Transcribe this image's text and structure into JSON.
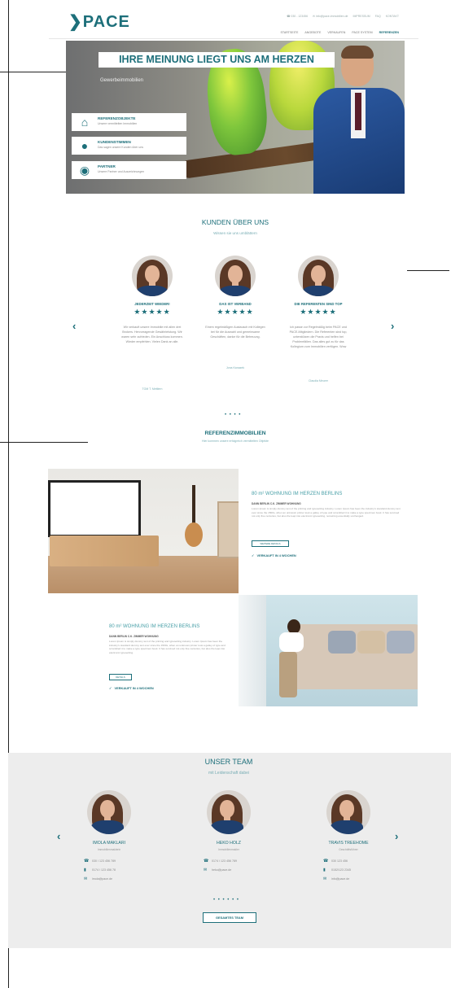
{
  "header": {
    "logo": "PACE",
    "logo_chevron": "❯",
    "top_info": [
      "☎ 030 - 123456",
      "✉ info@pace-immobilien.de",
      "IMPRESSUM",
      "FAQ",
      "KONTAKT"
    ],
    "nav": [
      "STARTSEITE",
      "ANGEBOTE",
      "VERKAUFEN",
      "PACE SYSTEM",
      "REFERENZEN"
    ],
    "active_nav": "REFERENZEN"
  },
  "hero": {
    "title": "IHRE MEINUNG LIEGT UNS AM HERZEN",
    "subtitle": "Gewerbeimmobilien",
    "items": [
      {
        "icon": "home-icon",
        "glyph": "⌂",
        "title": "REFERENZOBJEKTE",
        "desc": "Unsere vermittelten Immobilien"
      },
      {
        "icon": "person-icon",
        "glyph": "●",
        "title": "KUNDENSTIMMEN",
        "desc": "Das sagen unsere Kunden über uns"
      },
      {
        "icon": "speech-bubble-icon",
        "glyph": "◉",
        "title": "PARTNER",
        "desc": "Unsere Partner und Auszeichnungen"
      }
    ]
  },
  "kunden": {
    "title": "KUNDEN ÜBER UNS",
    "subtitle": "Wissen sie uns umblättern",
    "prev": "‹",
    "next": "›",
    "dots": "• • • •",
    "cards": [
      {
        "title": "JEDERZEIT WIEDER!",
        "stars": "★★★★★",
        "text": "Wir verkauft unsere Immobilie mit allen drei Brokers. Hervorragende Gewährleistung. Wir waren sehr zufrieden. Ein Anschluss kommen. Wieder empfehlen. Vielen Dank an alle.",
        "link": "TOM T. Mettlern"
      },
      {
        "title": "DAS IST VERBAND",
        "stars": "★★★★★",
        "text": "Einem regelmäßigen Austausch mit Kollegen bei für die Auswahl und gemeinsame Geschäften, danke für die Betreuung.",
        "link": "Jona Kanazek"
      },
      {
        "title": "DIE REFERENTEN SIND TOP",
        "stars": "★★★★★",
        "text": "Ich passe zur Regelmäßig beim PACE und PACE-Mitgliedern. Die Referenten sind top, unterstützen die Praxis und helfen bei Problemfällen. Das alles gut zu für das Kollegium zum Immobilien verfügen. Wow",
        "link": "Claudia Meurer"
      }
    ]
  },
  "referenz": {
    "title": "REFERENZIMMOBILIEN",
    "subtitle": "Hier kommen unsere erfolgreich vermittelten Objekte",
    "properties": [
      {
        "title": "80 m² WOHNUNG IM HERZEN BERLINS",
        "sub": "DANN BERLIN C.K. ZIMMER WOHNUNG",
        "text": "Lorem Ipsum is simply dummy text of the printing and typesetting industry. Lorem Ipsum has been the industry's standard dummy text ever since the 1500s, when an unknown printer took a galley of type and scrambled it to make a type specimen book. It has survived not only five centuries, but also the leap into electronic typesetting, remaining essentially unchanged.",
        "button": "WEITERE DETAILS",
        "sold": "VERKAUFT IN 4 WOCHEN"
      },
      {
        "title": "80 m² WOHNUNG IM HERZEN BERLINS",
        "sub": "DANN BERLIN C.K. ZIMMER WOHNUNG",
        "text": "Lorem Ipsum is simply dummy text of the printing and typesetting industry. Lorem Ipsum has been the industry's standard dummy text ever since the 1500s, when an unknown printer took a galley of type and scrambled it to make a type specimen book. It has survived not only five centuries, but also the leap into electronic typesetting.",
        "button": "DETAILS",
        "sold": "VERKAUFT IN 4 WOCHEN"
      }
    ]
  },
  "team": {
    "title": "UNSER TEAM",
    "subtitle": "mit Leidenschaft dabei",
    "prev": "‹",
    "next": "›",
    "dots": "• • • • • •",
    "button": "GESAMTES TEAM",
    "members": [
      {
        "name": "IMOLA MAKLARI",
        "role": "Immobilienmaklerin",
        "phone": "030 / 123 456 789",
        "mobile": "0174 / 123 456 78",
        "email": "imola@pace.de"
      },
      {
        "name": "HEKO HOLZ",
        "role": "Immobilienmakler",
        "phone": "0174 / 123 456 789",
        "mobile": "",
        "email": "heko@pace.de"
      },
      {
        "name": "TRAVIS TREEHOME",
        "role": "Geschäftsführer",
        "phone": "030 123 456",
        "mobile": "0152/123 2345",
        "email": "info@pace.de"
      }
    ]
  }
}
